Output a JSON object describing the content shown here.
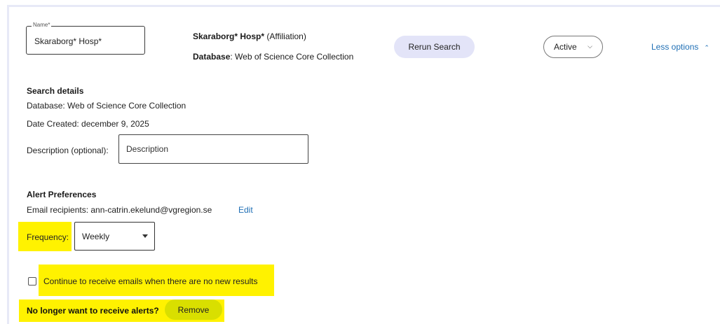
{
  "alert": {
    "name_legend": "Name*",
    "name_value": "Skaraborg* Hosp*",
    "query": "Skaraborg* Hosp*",
    "query_field": " (Affiliation)",
    "database_label": "Database",
    "database_value": ": Web of Science Core Collection",
    "rerun_label": "Rerun Search",
    "status_value": "Active",
    "less_options_label": "Less options"
  },
  "search_details": {
    "title": "Search details",
    "database_line": "Database:  Web of Science Core Collection",
    "date_line": "Date Created:  december 9, 2025",
    "description_label": "Description (optional):",
    "description_placeholder": "Description"
  },
  "alert_preferences": {
    "title": "Alert Preferences",
    "email_line": "Email recipients:  ann-catrin.ekelund@vgregion.se",
    "edit_label": "Edit",
    "frequency_label": "Frequency:",
    "frequency_value": "Weekly",
    "continue_label": "Continue to receive emails when there are no new results",
    "continue_checked": false,
    "remove_prompt": "No longer want to receive alerts?",
    "remove_label": "Remove"
  },
  "colors": {
    "highlight": "#fff200",
    "link": "#1f6fb5",
    "rerun_bg": "#e3e4f8",
    "remove_bg": "#d9df00"
  }
}
